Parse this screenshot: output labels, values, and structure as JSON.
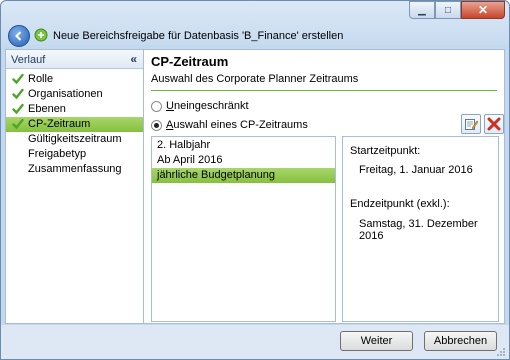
{
  "window": {
    "title": "Neue Bereichsfreigabe für Datenbasis 'B_Finance' erstellen",
    "controls": {
      "minimize": "▁",
      "maximize": "□",
      "close": "✕"
    }
  },
  "sidebar": {
    "header": "Verlauf",
    "collapse_glyph": "«",
    "items": [
      {
        "label": "Rolle",
        "done": true
      },
      {
        "label": "Organisationen",
        "done": true
      },
      {
        "label": "Ebenen",
        "done": true
      },
      {
        "label": "CP-Zeitraum",
        "done": true,
        "active": true
      },
      {
        "label": "Gültigkeitszeitraum",
        "done": false
      },
      {
        "label": "Freigabetyp",
        "done": false
      },
      {
        "label": "Zusammenfassung",
        "done": false
      }
    ]
  },
  "panel": {
    "title": "CP-Zeitraum",
    "subtitle": "Auswahl des Corporate Planner Zeitraums",
    "radio_unrestricted": {
      "accel": "U",
      "rest": "neingeschränkt",
      "selected": false
    },
    "radio_period": {
      "accel": "A",
      "rest": "uswahl eines CP-Zeitraums",
      "selected": true
    },
    "periods": [
      {
        "label": "2. Halbjahr",
        "selected": false
      },
      {
        "label": "Ab April 2016",
        "selected": false
      },
      {
        "label": "jährliche Budgetplanung",
        "selected": true
      }
    ],
    "detail": {
      "start_label": "Startzeitpunkt:",
      "start_value": "Freitag, 1. Januar 2016",
      "end_label": "Endzeitpunkt (exkl.):",
      "end_value": "Samstag, 31. Dezember 2016"
    }
  },
  "footer": {
    "next_label": "Weiter",
    "cancel_label": "Abbrechen"
  },
  "colors": {
    "selection_green": "#86c03f",
    "rule_green": "#6fb73c",
    "title_blue": "#c7dbf0"
  }
}
